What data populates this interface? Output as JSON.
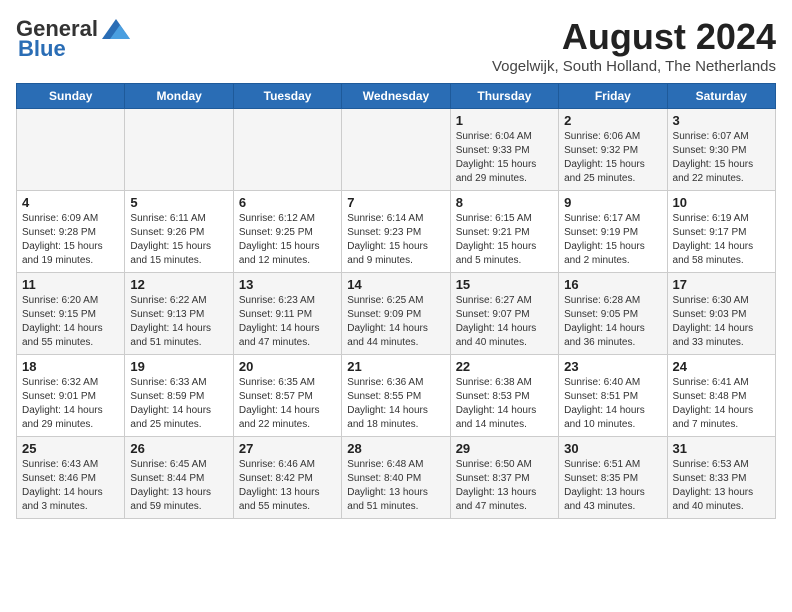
{
  "logo": {
    "part1": "General",
    "part2": "Blue"
  },
  "header": {
    "month_year": "August 2024",
    "location": "Vogelwijk, South Holland, The Netherlands"
  },
  "weekdays": [
    "Sunday",
    "Monday",
    "Tuesday",
    "Wednesday",
    "Thursday",
    "Friday",
    "Saturday"
  ],
  "weeks": [
    [
      {
        "day": "",
        "content": ""
      },
      {
        "day": "",
        "content": ""
      },
      {
        "day": "",
        "content": ""
      },
      {
        "day": "",
        "content": ""
      },
      {
        "day": "1",
        "content": "Sunrise: 6:04 AM\nSunset: 9:33 PM\nDaylight: 15 hours\nand 29 minutes."
      },
      {
        "day": "2",
        "content": "Sunrise: 6:06 AM\nSunset: 9:32 PM\nDaylight: 15 hours\nand 25 minutes."
      },
      {
        "day": "3",
        "content": "Sunrise: 6:07 AM\nSunset: 9:30 PM\nDaylight: 15 hours\nand 22 minutes."
      }
    ],
    [
      {
        "day": "4",
        "content": "Sunrise: 6:09 AM\nSunset: 9:28 PM\nDaylight: 15 hours\nand 19 minutes."
      },
      {
        "day": "5",
        "content": "Sunrise: 6:11 AM\nSunset: 9:26 PM\nDaylight: 15 hours\nand 15 minutes."
      },
      {
        "day": "6",
        "content": "Sunrise: 6:12 AM\nSunset: 9:25 PM\nDaylight: 15 hours\nand 12 minutes."
      },
      {
        "day": "7",
        "content": "Sunrise: 6:14 AM\nSunset: 9:23 PM\nDaylight: 15 hours\nand 9 minutes."
      },
      {
        "day": "8",
        "content": "Sunrise: 6:15 AM\nSunset: 9:21 PM\nDaylight: 15 hours\nand 5 minutes."
      },
      {
        "day": "9",
        "content": "Sunrise: 6:17 AM\nSunset: 9:19 PM\nDaylight: 15 hours\nand 2 minutes."
      },
      {
        "day": "10",
        "content": "Sunrise: 6:19 AM\nSunset: 9:17 PM\nDaylight: 14 hours\nand 58 minutes."
      }
    ],
    [
      {
        "day": "11",
        "content": "Sunrise: 6:20 AM\nSunset: 9:15 PM\nDaylight: 14 hours\nand 55 minutes."
      },
      {
        "day": "12",
        "content": "Sunrise: 6:22 AM\nSunset: 9:13 PM\nDaylight: 14 hours\nand 51 minutes."
      },
      {
        "day": "13",
        "content": "Sunrise: 6:23 AM\nSunset: 9:11 PM\nDaylight: 14 hours\nand 47 minutes."
      },
      {
        "day": "14",
        "content": "Sunrise: 6:25 AM\nSunset: 9:09 PM\nDaylight: 14 hours\nand 44 minutes."
      },
      {
        "day": "15",
        "content": "Sunrise: 6:27 AM\nSunset: 9:07 PM\nDaylight: 14 hours\nand 40 minutes."
      },
      {
        "day": "16",
        "content": "Sunrise: 6:28 AM\nSunset: 9:05 PM\nDaylight: 14 hours\nand 36 minutes."
      },
      {
        "day": "17",
        "content": "Sunrise: 6:30 AM\nSunset: 9:03 PM\nDaylight: 14 hours\nand 33 minutes."
      }
    ],
    [
      {
        "day": "18",
        "content": "Sunrise: 6:32 AM\nSunset: 9:01 PM\nDaylight: 14 hours\nand 29 minutes."
      },
      {
        "day": "19",
        "content": "Sunrise: 6:33 AM\nSunset: 8:59 PM\nDaylight: 14 hours\nand 25 minutes."
      },
      {
        "day": "20",
        "content": "Sunrise: 6:35 AM\nSunset: 8:57 PM\nDaylight: 14 hours\nand 22 minutes."
      },
      {
        "day": "21",
        "content": "Sunrise: 6:36 AM\nSunset: 8:55 PM\nDaylight: 14 hours\nand 18 minutes."
      },
      {
        "day": "22",
        "content": "Sunrise: 6:38 AM\nSunset: 8:53 PM\nDaylight: 14 hours\nand 14 minutes."
      },
      {
        "day": "23",
        "content": "Sunrise: 6:40 AM\nSunset: 8:51 PM\nDaylight: 14 hours\nand 10 minutes."
      },
      {
        "day": "24",
        "content": "Sunrise: 6:41 AM\nSunset: 8:48 PM\nDaylight: 14 hours\nand 7 minutes."
      }
    ],
    [
      {
        "day": "25",
        "content": "Sunrise: 6:43 AM\nSunset: 8:46 PM\nDaylight: 14 hours\nand 3 minutes."
      },
      {
        "day": "26",
        "content": "Sunrise: 6:45 AM\nSunset: 8:44 PM\nDaylight: 13 hours\nand 59 minutes."
      },
      {
        "day": "27",
        "content": "Sunrise: 6:46 AM\nSunset: 8:42 PM\nDaylight: 13 hours\nand 55 minutes."
      },
      {
        "day": "28",
        "content": "Sunrise: 6:48 AM\nSunset: 8:40 PM\nDaylight: 13 hours\nand 51 minutes."
      },
      {
        "day": "29",
        "content": "Sunrise: 6:50 AM\nSunset: 8:37 PM\nDaylight: 13 hours\nand 47 minutes."
      },
      {
        "day": "30",
        "content": "Sunrise: 6:51 AM\nSunset: 8:35 PM\nDaylight: 13 hours\nand 43 minutes."
      },
      {
        "day": "31",
        "content": "Sunrise: 6:53 AM\nSunset: 8:33 PM\nDaylight: 13 hours\nand 40 minutes."
      }
    ]
  ]
}
